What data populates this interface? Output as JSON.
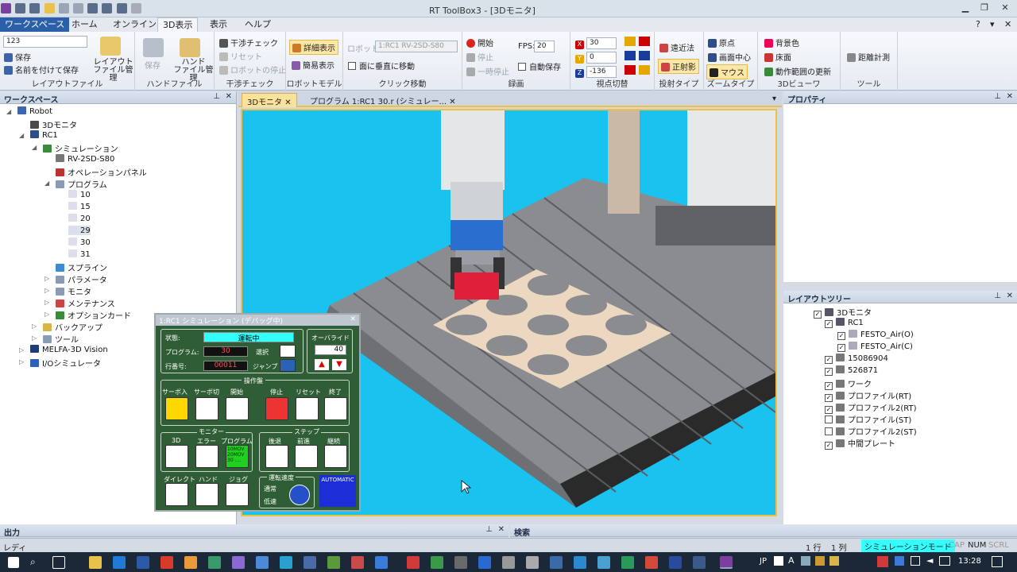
{
  "app": {
    "title": "RT ToolBox3 - [3Dモニタ]"
  },
  "ribbon_tabs": [
    "ワークスペース",
    "ホーム",
    "オンライン",
    "3D表示",
    "表示",
    "ヘルプ"
  ],
  "ribbon": {
    "layout_file": {
      "combo_value": "123",
      "save": "保存",
      "save_as": "名前を付けて保存",
      "layout_mgmt": "レイアウト\nファイル管理",
      "label": "レイアウトファイル"
    },
    "hand_file": {
      "save": "保存",
      "hand_mgmt": "ハンド\nファイル管理",
      "label": "ハンドファイル"
    },
    "interference": {
      "check": "干渉チェック",
      "reset": "リセット",
      "robot_stop": "ロボットの停止",
      "label": "干渉チェック"
    },
    "robot_model": {
      "detail": "詳細表示",
      "simple": "簡易表示",
      "label": "ロボットモデル"
    },
    "click_move": {
      "robot_label": "ロボット:",
      "robot_value": "1:RC1 RV-2SD-S80",
      "perpendicular": "面に垂直に移動",
      "label": "クリック移動"
    },
    "recording": {
      "start": "開始",
      "stop": "停止",
      "pause": "一時停止",
      "fps_label": "FPS:",
      "fps_value": "20",
      "autosave": "自動保存",
      "label": "録画"
    },
    "viewpoint": {
      "x": "30",
      "y": "0",
      "z": "-136",
      "label": "視点切替"
    },
    "projection": {
      "perspective": "遠近法",
      "orthographic": "正射影",
      "label": "投射タイプ"
    },
    "zoom": {
      "origin": "原点",
      "screen_center": "画面中心",
      "mouse": "マウス",
      "label": "ズームタイプ"
    },
    "viewer3d": {
      "bg_color": "背景色",
      "floor": "床面",
      "update_range": "動作範囲の更新",
      "label": "3Dビューワ"
    },
    "tools": {
      "distance": "距離計測",
      "label": "ツール"
    }
  },
  "workspace": {
    "title": "ワークスペース",
    "items": [
      "Robot",
      "3Dモニタ",
      "RC1",
      "シミュレーション",
      "RV-2SD-S80",
      "オペレーションパネル",
      "プログラム",
      "10",
      "15",
      "20",
      "29",
      "30",
      "31",
      "スプライン",
      "パラメータ",
      "モニタ",
      "メンテナンス",
      "オプションカード",
      "バックアップ",
      "ツール",
      "MELFA-3D Vision",
      "I/Oシミュレータ"
    ]
  },
  "doc_tabs": [
    "3Dモニタ",
    "プログラム 1:RC1 30.r (シミュレー..."
  ],
  "properties": {
    "title": "プロパティ"
  },
  "layout_tree": {
    "title": "レイアウトツリー",
    "items": [
      {
        "label": "3Dモニタ",
        "checked": true
      },
      {
        "label": "RC1",
        "checked": true
      },
      {
        "label": "FESTO_Air(O)",
        "checked": true
      },
      {
        "label": "FESTO_Air(C)",
        "checked": true
      },
      {
        "label": "15086904",
        "checked": true
      },
      {
        "label": "526871",
        "checked": true
      },
      {
        "label": "ワーク",
        "checked": true
      },
      {
        "label": "プロファイル(RT)",
        "checked": true
      },
      {
        "label": "プロファイル2(RT)",
        "checked": true
      },
      {
        "label": "プロファイル(ST)",
        "checked": false
      },
      {
        "label": "プロファイル2(ST)",
        "checked": false
      },
      {
        "label": "中間プレート",
        "checked": true
      }
    ]
  },
  "op_panel": {
    "title": "1:RC1 シミュレーション (デバッグ中)",
    "status_label": "状態:",
    "status_value": "運転中",
    "program_label": "プログラム:",
    "program_value": "30",
    "select": "選択",
    "line_label": "行番号:",
    "line_value": "00011",
    "jump": "ジャンプ",
    "override_label": "オーバライド",
    "override_value": "40",
    "ops_label": "操作盤",
    "servo_on": "サーボ入",
    "servo_off": "サーボ切",
    "start": "開始",
    "stop": "停止",
    "reset": "リセット",
    "end": "終了",
    "monitor_label": "モニター",
    "m3d": "3D",
    "error": "エラー",
    "program": "プログラム",
    "program_screen": "10MOV\n20MOV\n30 ....",
    "step_label": "ステップ",
    "back": "後退",
    "forward": "前進",
    "continue": "継続",
    "direct": "ダイレクト",
    "hand": "ハンド",
    "jog": "ジョグ",
    "speed_label": "運転速度",
    "normal": "通常",
    "low": "低速",
    "automatic": "AUTOMATIC"
  },
  "output": {
    "title": "出力"
  },
  "search": {
    "title": "検索"
  },
  "status": {
    "left": "レディ",
    "row": "1 行",
    "col": "1 列",
    "mode": "シミュレーションモード",
    "cap": "CAP",
    "num": "NUM",
    "scrl": "SCRL"
  },
  "taskbar": {
    "ime": "JP",
    "time": "13:28"
  },
  "colors": {
    "sky": "#19c2ef",
    "panel_green": "#2f5d35",
    "accent_blue": "#2b5fa8",
    "highlight": "#fde7a5"
  }
}
